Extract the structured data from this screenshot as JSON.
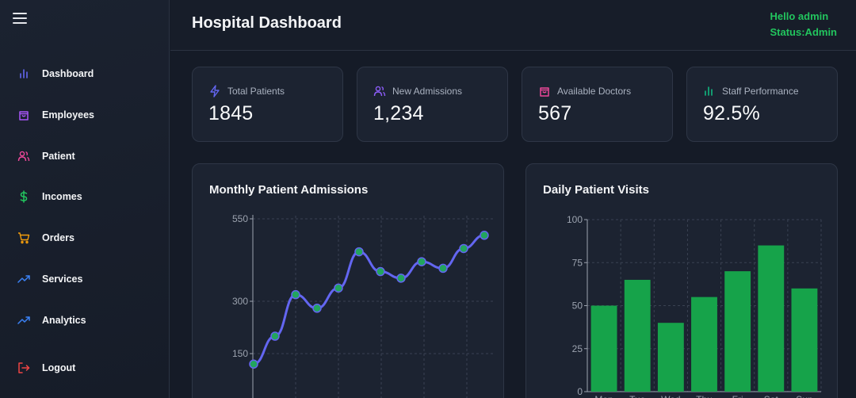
{
  "sidebar": {
    "items": [
      {
        "label": "Dashboard",
        "icon": "bar-chart-icon",
        "color": "#6366f1"
      },
      {
        "label": "Employees",
        "icon": "shopping-bag-icon",
        "color": "#a855f7"
      },
      {
        "label": "Patient",
        "icon": "users-icon",
        "color": "#ec4899"
      },
      {
        "label": "Incomes",
        "icon": "dollar-icon",
        "color": "#22c55e"
      },
      {
        "label": "Orders",
        "icon": "cart-icon",
        "color": "#f59e0b"
      },
      {
        "label": "Services",
        "icon": "trend-up-icon",
        "color": "#3b82f6"
      },
      {
        "label": "Analytics",
        "icon": "trend-up-icon",
        "color": "#3b82f6"
      },
      {
        "label": "Logout",
        "icon": "logout-icon",
        "color": "#ef4444"
      }
    ]
  },
  "header": {
    "title": "Hospital Dashboard",
    "greeting": "Hello admin",
    "status": "Status:Admin",
    "accent": "#22c55e"
  },
  "stats": [
    {
      "label": "Total Patients",
      "value": "1845",
      "icon": "zap-icon",
      "color": "#6366f1"
    },
    {
      "label": "New Admissions",
      "value": "1,234",
      "icon": "users-icon",
      "color": "#8b5cf6"
    },
    {
      "label": "Available Doctors",
      "value": "567",
      "icon": "shopping-bag-icon",
      "color": "#ec4899"
    },
    {
      "label": "Staff Performance",
      "value": "92.5%",
      "icon": "bar-chart-icon",
      "color": "#10b981"
    }
  ],
  "chart_data": [
    {
      "type": "line",
      "title": "Monthly Patient Admissions",
      "x": [
        1,
        2,
        3,
        4,
        5,
        6,
        7,
        8,
        9,
        10,
        11,
        12
      ],
      "values": [
        120,
        200,
        320,
        280,
        340,
        450,
        390,
        370,
        420,
        400,
        460,
        500
      ],
      "ytick_labels": [
        "150",
        "300",
        "550"
      ],
      "yticks": [
        150,
        300,
        550
      ],
      "ylim": [
        0,
        560
      ],
      "grid": true,
      "line_color": "#6366f1",
      "point_color": "#22a55e"
    },
    {
      "type": "bar",
      "title": "Daily Patient Visits",
      "categories": [
        "Mon",
        "Tue",
        "Wed",
        "Thu",
        "Fri",
        "Sat",
        "Sun"
      ],
      "values": [
        50,
        65,
        40,
        55,
        70,
        85,
        60
      ],
      "yticks": [
        0,
        25,
        50,
        75,
        100
      ],
      "ytick_labels": [
        "0",
        "25",
        "50",
        "75",
        "100"
      ],
      "ylim": [
        0,
        100
      ],
      "grid": true,
      "bar_color": "#16a34a"
    }
  ]
}
